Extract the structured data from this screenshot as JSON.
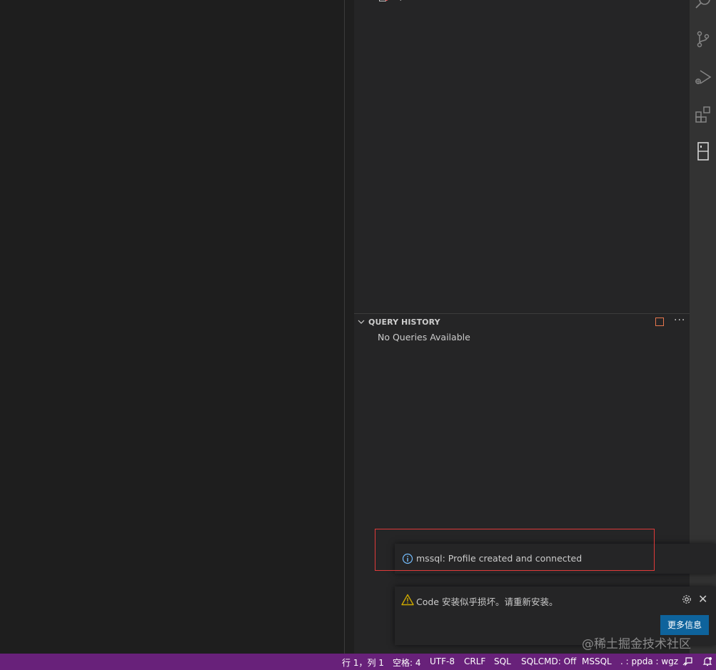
{
  "explorer": {
    "tree_item_label": "sql",
    "query_history": {
      "title": "QUERY HISTORY",
      "empty_message": "No Queries Available",
      "more_actions": "···"
    }
  },
  "activity_bar": {
    "icons": [
      "search-icon",
      "source-control-icon",
      "run-debug-icon",
      "extensions-icon",
      "sql-server-icon"
    ]
  },
  "notifications": {
    "info": {
      "message": "mssql: Profile created and connected"
    },
    "warning": {
      "message": "Code 安装似乎损坏。请重新安装。",
      "close_glyph": "✕",
      "more_info_button": "更多信息"
    }
  },
  "watermark": "@稀土掘金技术社区",
  "status_bar": {
    "position": "行 1，列 1",
    "spaces": "空格: 4",
    "encoding": "UTF-8",
    "eol": "CRLF",
    "language": "SQL",
    "sqlcmd": "SQLCMD: Off",
    "mssql": "MSSQL",
    "connection": ". : ppda : wgz"
  },
  "colors": {
    "status_bar": "#68217a",
    "sidebar": "#252526",
    "editor": "#1e1e1e",
    "button": "#0e639c",
    "highlight": "#e03a3a",
    "info_icon": "#75beff",
    "warning_icon": "#cca700"
  }
}
